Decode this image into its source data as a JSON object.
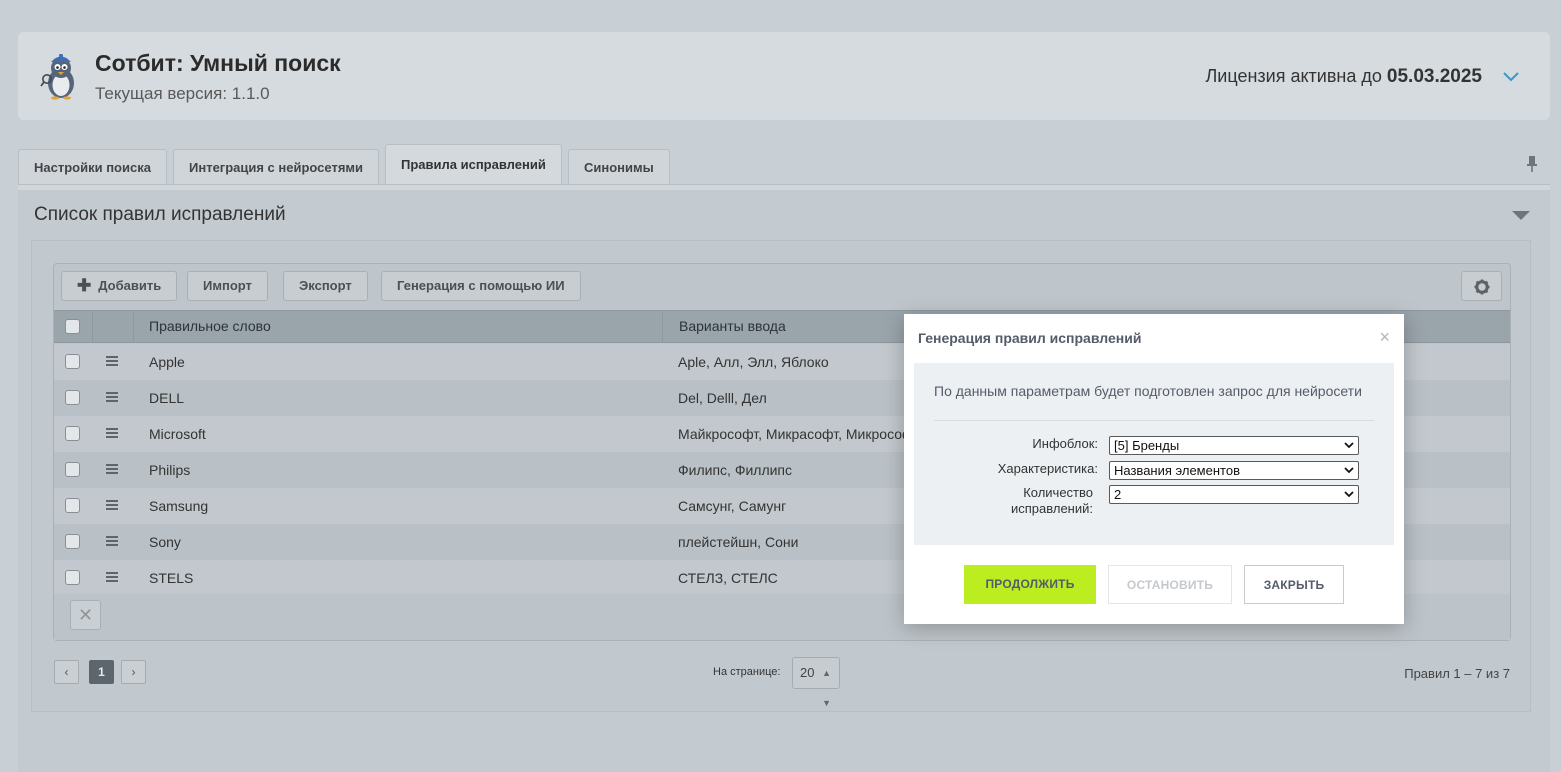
{
  "header": {
    "title": "Сотбит: Умный поиск",
    "version": "Текущая версия: 1.1.0",
    "license_prefix": "Лицензия активна до",
    "license_date": "05.03.2025"
  },
  "tabs": [
    {
      "label": "Настройки поиска"
    },
    {
      "label": "Интеграция с нейросетями"
    },
    {
      "label": "Правила исправлений",
      "active": true
    },
    {
      "label": "Синонимы"
    }
  ],
  "panel": {
    "title": "Список правил исправлений"
  },
  "toolbar": {
    "add": "Добавить",
    "import": "Импорт",
    "export": "Экспорт",
    "generate": "Генерация с помощью ИИ"
  },
  "table": {
    "columns": [
      "Правильное слово",
      "Варианты ввода"
    ],
    "rows": [
      {
        "word": "Apple",
        "variants": "Aple, Алл, Элл, Яблоко"
      },
      {
        "word": "DELL",
        "variants": "Del, Delll, Дел"
      },
      {
        "word": "Microsoft",
        "variants": "Майкрософт, Микрасофт, Микрософт"
      },
      {
        "word": "Philips",
        "variants": "Филипс, Филлипс"
      },
      {
        "word": "Samsung",
        "variants": "Самсунг, Самунг"
      },
      {
        "word": "Sony",
        "variants": "плейстейшн, Сони"
      },
      {
        "word": "STELS",
        "variants": "СТЕЛЗ, СТЕЛС"
      }
    ]
  },
  "pagination": {
    "current_page": "1",
    "per_page_label": "На странице:",
    "per_page_value": "20",
    "total": "Правил 1 – 7 из 7"
  },
  "dialog": {
    "title": "Генерация правил исправлений",
    "description": "По данным параметрам будет подготовлен запрос для нейросети",
    "fields": [
      {
        "label": "Инфоблок:",
        "value": "[5] Бренды"
      },
      {
        "label": "Характеристика:",
        "value": "Названия элементов"
      },
      {
        "label": "Количество исправлений:",
        "value": "2"
      }
    ],
    "buttons": {
      "continue": "ПРОДОЛЖИТЬ",
      "stop": "ОСТАНОВИТЬ",
      "close": "ЗАКРЫТЬ"
    }
  },
  "colors": {
    "accent_button": "#bbed21",
    "overlay_background": "#c8d0d6"
  },
  "icons": [
    "penguin-logo-icon",
    "chevron-down-icon",
    "pin-icon",
    "plus-icon",
    "gear-icon",
    "drag-handle-icon",
    "close-icon"
  ]
}
